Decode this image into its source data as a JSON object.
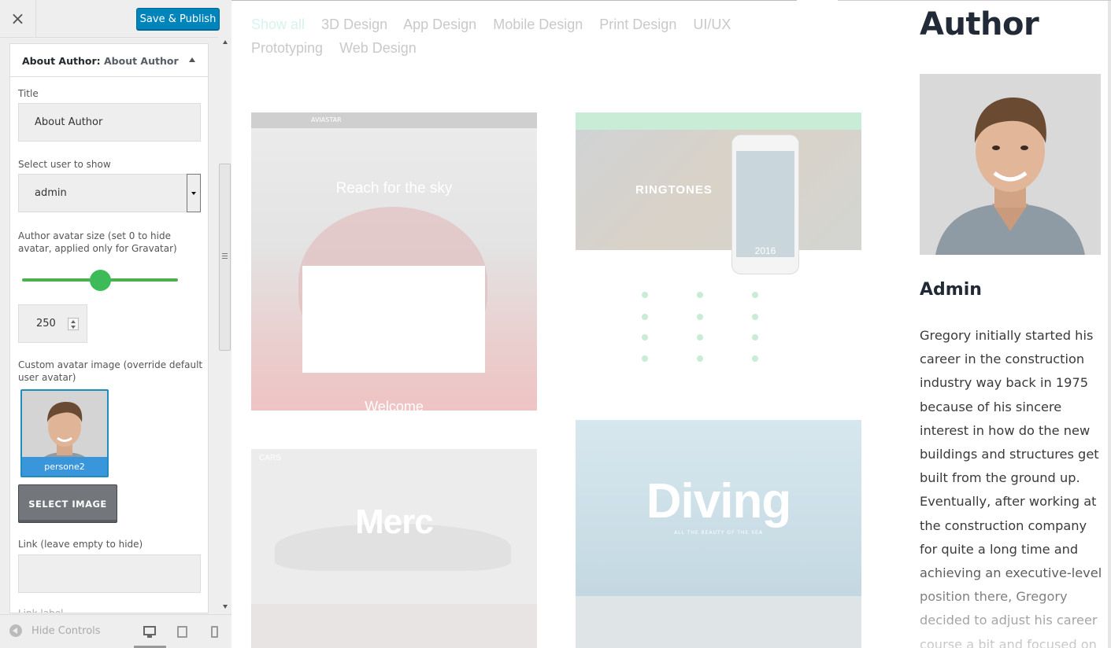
{
  "header": {
    "close_label": "×",
    "publish_label": "Save & Publish"
  },
  "section": {
    "prefix": "About Author:",
    "title": "About Author"
  },
  "fields": {
    "title_label": "Title",
    "title_value": "About Author",
    "user_label": "Select user to show",
    "user_value": "admin",
    "avatar_size_label": "Author avatar size (set 0 to hide avatar, applied only for Gravatar)",
    "avatar_size_value": "250",
    "avatar_size_slider_level": 0.5,
    "custom_avatar_label": "Custom avatar image (override default user avatar)",
    "custom_avatar_filename": "persone2",
    "select_image_label": "SELECT IMAGE",
    "link_label": "Link (leave empty to hide)",
    "link_value": "",
    "link_label_label": "Link label"
  },
  "footer": {
    "hide_controls_label": "Hide Controls",
    "devices": [
      "desktop",
      "tablet",
      "mobile"
    ],
    "active_device": "desktop"
  },
  "preview": {
    "filters": [
      "Show all",
      "3D Design",
      "App Design",
      "Mobile Design",
      "Print Design",
      "UI/UX Prototyping",
      "Web Design"
    ],
    "active_filter": "Show all",
    "cards": {
      "aviastar_logo": "AVIASTAR",
      "aviastar_headline": "Reach for the sky",
      "aviastar_footer": "Welcome",
      "ringtones_title": "RINGTONES",
      "ringtones_year": "2016",
      "cars_logo": "CARS",
      "cars_title": "Merc",
      "diving_title": "Diving",
      "diving_tagline": "ALL THE BEAUTY OF THE SEA"
    },
    "author": {
      "heading": "Author",
      "name": "Admin",
      "bio": "Gregory initially started his career in the construction industry way back in 1975 because of his sincere interest in how do the new buildings and structures get built from the ground up. Eventually, after working at the construction company for quite a long time and achieving an executive-level position there, Gregory decided to adjust his career course a bit and focused on"
    }
  },
  "colors": {
    "publish_bg": "#0085ba",
    "slider": "#3dbb58",
    "accent_selected": "#3a96db",
    "heading": "#222a38"
  }
}
